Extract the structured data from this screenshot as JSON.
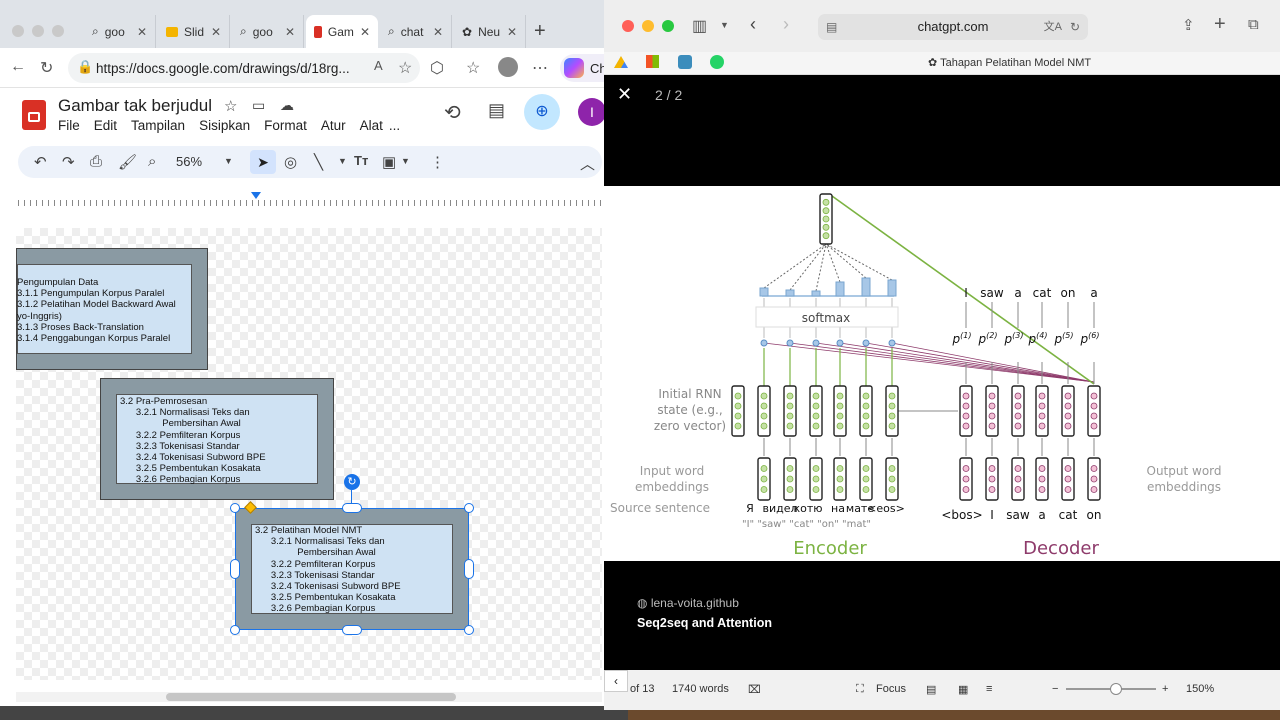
{
  "edge": {
    "tabs": [
      {
        "label": "goo",
        "icon": "search-icon"
      },
      {
        "label": "Slid",
        "icon": "slides-icon"
      },
      {
        "label": "goo",
        "icon": "search-icon"
      },
      {
        "label": "Gam",
        "icon": "drawings-icon",
        "active": true
      },
      {
        "label": "chat",
        "icon": "search-icon"
      },
      {
        "label": "Neu",
        "icon": "openai-icon"
      }
    ],
    "new_tab": "+",
    "url": "https://docs.google.com/drawings/d/18rg...",
    "copilot_label": "Ch"
  },
  "docs": {
    "title": "Gambar tak berjudul",
    "menu": [
      "File",
      "Edit",
      "Tampilan",
      "Sisipkan",
      "Format",
      "Atur",
      "Alat",
      "..."
    ],
    "zoom": "56%",
    "avatar": "I"
  },
  "boxes": {
    "box1": "Pengumpulan Data\n3.1.1 Pengumpulan Korpus Paralel\n3.1.2 Pelatihan Model Backward Awal\nyo-Inggris)\n3.1.3 Proses Back-Translation\n3.1.4 Penggabungan Korpus Paralel",
    "box2": "3.2 Pra-Pemrosesan\n      3.2.1 Normalisasi Teks dan\n                Pembersihan Awal\n      3.2.2 Pemfilteran Korpus\n      3.2.3 Tokenisasi Standar\n      3.2.4 Tokenisasi Subword BPE\n      3.2.5 Pembentukan Kosakata\n      3.2.6 Pembagian Korpus",
    "box3": "3.2 Pelatihan Model NMT\n      3.2.1 Normalisasi Teks dan\n                Pembersihan Awal\n      3.2.2 Pemfilteran Korpus\n      3.2.3 Tokenisasi Standar\n      3.2.4 Tokenisasi Subword BPE\n      3.2.5 Pembentukan Kosakata\n      3.2.6 Pembagian Korpus"
  },
  "safari": {
    "url": "chatgpt.com",
    "page_title": "Tahapan Pelatihan Model NMT",
    "counter": "2 / 2",
    "source": "lena-voita.github",
    "caption": "Seq2seq and Attention"
  },
  "diagram": {
    "softmax": "softmax",
    "initial_state": [
      "Initial RNN",
      "state (e.g.,",
      "zero vector)"
    ],
    "input_emb": [
      "Input word",
      "embeddings"
    ],
    "source_sentence": "Source sentence",
    "output_emb": [
      "Output word",
      "embeddings"
    ],
    "source_tokens": [
      "Я",
      "видел",
      "котю",
      "на",
      "мате",
      "<eos>"
    ],
    "source_gloss": "\"I\" \"saw\"  \"cat\"  \"on\"  \"mat\"",
    "target_in": [
      "<bos>",
      "I",
      "saw",
      "a",
      "cat",
      "on"
    ],
    "target_out": [
      "I",
      "saw",
      "a",
      "cat",
      "on",
      "a"
    ],
    "probs": [
      "p(1)",
      "p(2)",
      "p(3)",
      "p(4)",
      "p(5)",
      "p(6)"
    ],
    "encoder": "Encoder",
    "decoder": "Decoder",
    "encoder_color": "#7cb342",
    "decoder_color": "#8e3b6b"
  },
  "word_status": {
    "pages": "of 13",
    "words": "1740 words",
    "focus": "Focus",
    "zoom": "150%"
  }
}
